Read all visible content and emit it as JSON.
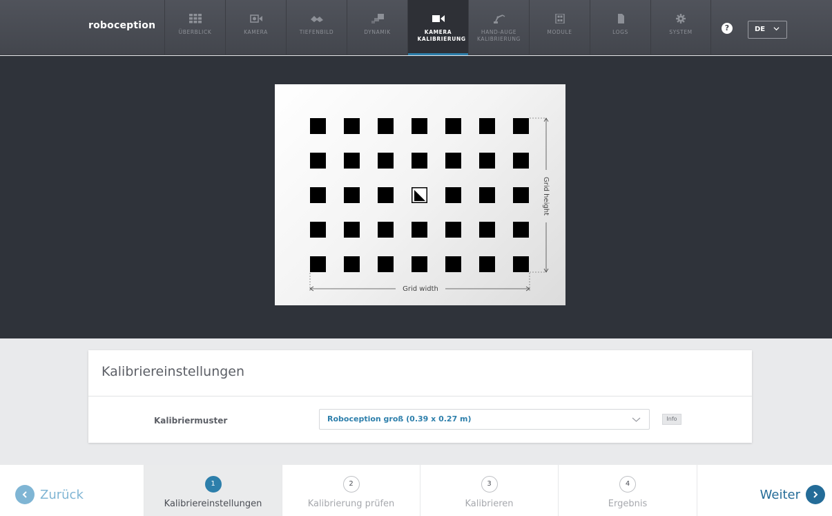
{
  "app": {
    "logo": "roboception"
  },
  "nav": {
    "items": [
      {
        "label": "ÜBERBLICK",
        "icon": "overview-grid-icon",
        "active": false
      },
      {
        "label": "KAMERA",
        "icon": "camera-icon",
        "active": false
      },
      {
        "label": "TIEFENBILD",
        "icon": "depth-image-icon",
        "active": false
      },
      {
        "label": "DYNAMIK",
        "icon": "dynamics-icon",
        "active": false
      },
      {
        "label": "KAMERA KALIBRIERUNG",
        "icon": "video-camera-icon",
        "active": true
      },
      {
        "label": "HAND-AUGE KALIBRIERUNG",
        "icon": "robot-arm-icon",
        "active": false
      },
      {
        "label": "MODULE",
        "icon": "modules-icon",
        "active": false
      },
      {
        "label": "LOGS",
        "icon": "document-icon",
        "active": false
      },
      {
        "label": "SYSTEM",
        "icon": "gear-icon",
        "active": false
      }
    ],
    "help": "?",
    "language": "DE"
  },
  "pattern": {
    "rows": 5,
    "cols": 7,
    "marker": {
      "row": 2,
      "col": 3
    },
    "grid_width_label": "Grid width",
    "grid_height_label": "Grid height"
  },
  "settings": {
    "title": "Kalibriereinstellungen",
    "pattern_label": "Kalibriermuster",
    "pattern_value": "Roboception groß (0.39 x 0.27 m)",
    "info_label": "Info"
  },
  "wizard": {
    "back_label": "Zurück",
    "next_label": "Weiter",
    "steps": [
      {
        "num": "1",
        "label": "Kalibriereinstellungen",
        "active": true
      },
      {
        "num": "2",
        "label": "Kalibrierung prüfen",
        "active": false
      },
      {
        "num": "3",
        "label": "Kalibrieren",
        "active": false
      },
      {
        "num": "4",
        "label": "Ergebnis",
        "active": false
      }
    ]
  },
  "colors": {
    "accent": "#2d7fab",
    "nav_bg": "#4a4d54",
    "stage_bg": "#2f333a"
  }
}
